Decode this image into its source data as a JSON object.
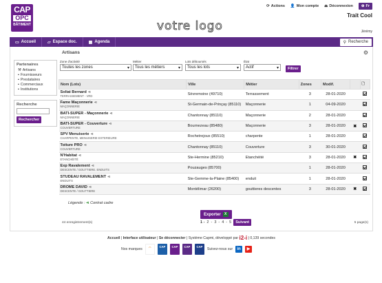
{
  "header": {
    "logo_line1": "CAP",
    "logo_line2": "OPC",
    "logo_line3": "BÂTIMENT",
    "votre_logo": "votre logo",
    "actions": "Actions",
    "mon_compte": "Mon compte",
    "deconnexion": "Déconnexion",
    "lang": "Fr",
    "org": "Trait Cool",
    "user": "Jérémy"
  },
  "menu": {
    "accueil": "Accueil",
    "espace_doc": "Espace doc.",
    "agenda": "Agenda",
    "recherche": "Recherche"
  },
  "page_title": "Artisans",
  "sidebar": {
    "partenaires_title": "Partenaires",
    "items": [
      "Artisans",
      "Fournisseurs",
      "Prestataires",
      "Commerciaux",
      "Institutions"
    ],
    "recherche_title": "Recherche",
    "rechercher_btn": "Rechercher"
  },
  "filters": {
    "zone_label": "Zone d'activité",
    "zone_value": "Toutes les zones",
    "metier_label": "Métier",
    "metier_value": "Tous les métiers",
    "lots_label": "Lots déboursés",
    "lots_value": "Tous les lots",
    "etat_label": "État",
    "etat_value": "Actif",
    "filtrer_btn": "Filtrer"
  },
  "table": {
    "headers": [
      "Nom (Lots)",
      "Ville",
      "Métier",
      "Zones",
      "Modif."
    ],
    "rows": [
      {
        "nom": "Soliat Bernard",
        "cat": "TERRASSEMENT - VRD",
        "ville": "Sèvremoine (49710)",
        "metier": "Terrassement",
        "zones": "3",
        "modif": "28-01-2020",
        "x": false
      },
      {
        "nom": "Fame Maçonnerie",
        "cat": "MAÇONNERIE",
        "ville": "St-Germain-de-Prinçay (85110)",
        "metier": "Maçonnerie",
        "zones": "1",
        "modif": "04-09-2020",
        "x": false
      },
      {
        "nom": "BATI-SUPER - Maçonnerie",
        "cat": "MAÇONNERIE",
        "ville": "Chantonnay (85110)",
        "metier": "Maçonnerie",
        "zones": "2",
        "modif": "28-01-2020",
        "x": false
      },
      {
        "nom": "BATI-SUPER - Couverture",
        "cat": "COUVERTURE",
        "ville": "Bournezeau (85480)",
        "metier": "Maçonnerie",
        "zones": "3",
        "modif": "28-01-2020",
        "x": true
      },
      {
        "nom": "SPV Menuiserie",
        "cat": "CHARPENTE, MENUISERIE EXTERIEURE",
        "ville": "Rochetrejoux (85510)",
        "metier": "charpente",
        "zones": "1",
        "modif": "28-01-2020",
        "x": false
      },
      {
        "nom": "Toiture PRO",
        "cat": "COUVERTURE",
        "ville": "Chantonnay (85110)",
        "metier": "Couverture",
        "zones": "3",
        "modif": "30-01-2020",
        "x": false
      },
      {
        "nom": "N'Habitat",
        "cat": "ETANCHÉITÉ",
        "ville": "Ste-Hermine (85210)",
        "metier": "Etanchéité",
        "zones": "3",
        "modif": "28-01-2020",
        "x": true
      },
      {
        "nom": "Exp Ravalement",
        "cat": "DESCENTE / GOUTTIERE. ENDUITS",
        "ville": "Pouzauges (85700)",
        "metier": "",
        "zones": "1",
        "modif": "28-01-2020",
        "x": false
      },
      {
        "nom": "STUDEAU RAVALEMENT",
        "cat": "ENDUITS",
        "ville": "Ste-Gemme-la-Plaine (85400)",
        "metier": "enduit",
        "zones": "1",
        "modif": "28-01-2020",
        "x": false
      },
      {
        "nom": "DROME DAVID",
        "cat": "DESCENTE / GOUTTIERE",
        "ville": "Montélimar (26200)",
        "metier": "gouttieres descentes",
        "zones": "3",
        "modif": "28-01-2020",
        "x": true
      }
    ]
  },
  "legend": {
    "label": "Légende :",
    "text": "Contrat cadre"
  },
  "exporter": "Exporter",
  "count": "44 enregistrement(s)",
  "pager": {
    "prefix": "1 -",
    "pages": [
      "2",
      "3",
      "4",
      "5"
    ],
    "suivant": "Suivant"
  },
  "page_of": "5 page(s)",
  "footer": {
    "accueil": "Accueil",
    "interface": "Interface utilisateur",
    "deconnecter": "Se déconnecter",
    "systeme": "Système Capmi, développé par",
    "timing": "0,139 secondes",
    "nos_marques": "Nos marques",
    "suivez": "Suivez-nous sur"
  }
}
